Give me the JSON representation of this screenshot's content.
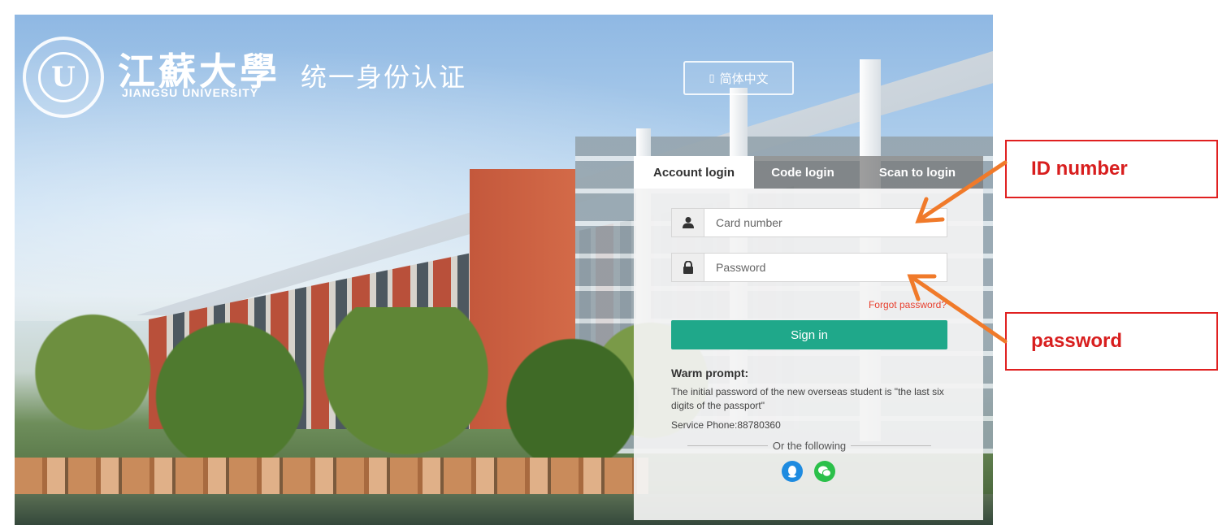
{
  "header": {
    "university_name_cn": "江蘇大學",
    "university_name_en": "JIANGSU UNIVERSITY",
    "system_title": "统一身份认证",
    "seal_letter": "U"
  },
  "language": {
    "label": "简体中文"
  },
  "login": {
    "tabs": [
      {
        "label": "Account login",
        "active": true
      },
      {
        "label": "Code login",
        "active": false
      },
      {
        "label": "Scan to login",
        "active": false
      }
    ],
    "card_field": {
      "placeholder": "Card number",
      "icon": "user-icon"
    },
    "password_field": {
      "placeholder": "Password",
      "icon": "lock-icon"
    },
    "forgot_label": "Forgot password?",
    "signin_label": "Sign in",
    "warm_prompt_title": "Warm prompt:",
    "warm_prompt_text": "The initial password of the new overseas student is \"the last six digits of the passport\"",
    "service_phone": "Service Phone:88780360",
    "or_label": "Or the following",
    "social_icons": [
      "qq-icon",
      "wechat-icon"
    ]
  },
  "annotations": {
    "id_label": "ID number",
    "password_label": "password",
    "color": "#d81e1e",
    "arrow_color": "#f07a2a"
  },
  "colors": {
    "signin_button": "#1fa88a",
    "forgot_link": "#e8402f",
    "qq": "#1e8be0",
    "wechat": "#2bc04a"
  }
}
